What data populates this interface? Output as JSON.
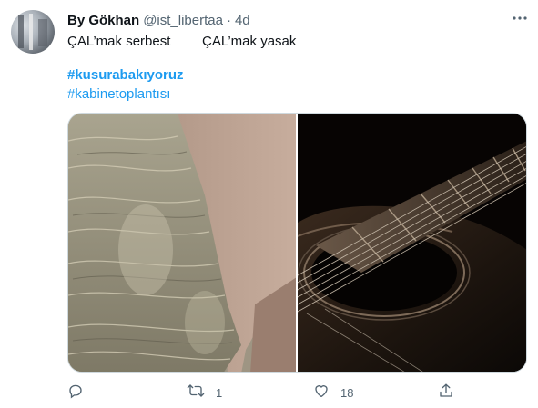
{
  "tweet": {
    "author_name": "By Gökhan",
    "author_handle": "@ist_libertaa",
    "separator": "·",
    "time": "4d",
    "text_part1": "ÇAL’mak serbest",
    "text_part2": "ÇAL’mak yasak",
    "hashtags": [
      "#kusurabakıyoruz",
      "#kabinetoplantısı"
    ]
  },
  "media": {
    "left_image": "stacks-of-banknotes-in-box",
    "right_image": "acoustic-guitar-closeup"
  },
  "actions": {
    "reply_count": "",
    "retweet_count": "1",
    "like_count": "18"
  },
  "icons": {
    "reply": "reply-icon",
    "retweet": "retweet-icon",
    "like": "heart-icon",
    "share": "share-icon",
    "more": "more-dots-icon"
  },
  "colors": {
    "accent": "#1d9bf0",
    "text_primary": "#0f1419",
    "text_secondary": "#536471",
    "border": "#cfd9de"
  }
}
